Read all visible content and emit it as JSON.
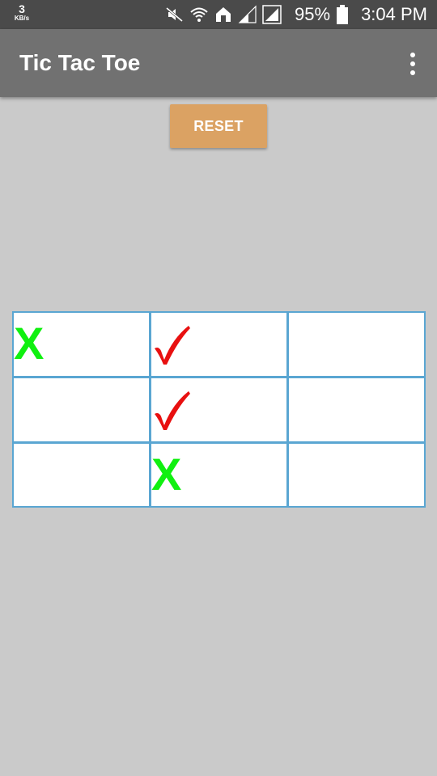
{
  "status_bar": {
    "speed_value": "3",
    "speed_unit": "KB/s",
    "battery_percent": "95%",
    "time": "3:04 PM",
    "icons": [
      "mute-icon",
      "wifi-icon",
      "home-icon",
      "signal-icon",
      "signal-full-icon",
      "battery-icon"
    ]
  },
  "app_bar": {
    "title": "Tic Tac Toe",
    "menu_icon": "more-vert-icon"
  },
  "reset_button": {
    "label": "RESET",
    "color": "#dba263"
  },
  "board": {
    "cells": [
      [
        "X",
        "✓",
        ""
      ],
      [
        "",
        "✓",
        ""
      ],
      [
        "",
        "X",
        ""
      ]
    ],
    "x_mark_text": "X",
    "x_color": "#10f010",
    "check_color": "#e81010",
    "grid_color": "#5aa6d2"
  },
  "colors": {
    "background": "#cacaca",
    "status_bar": "#4a4a4a",
    "app_bar": "#717171"
  }
}
